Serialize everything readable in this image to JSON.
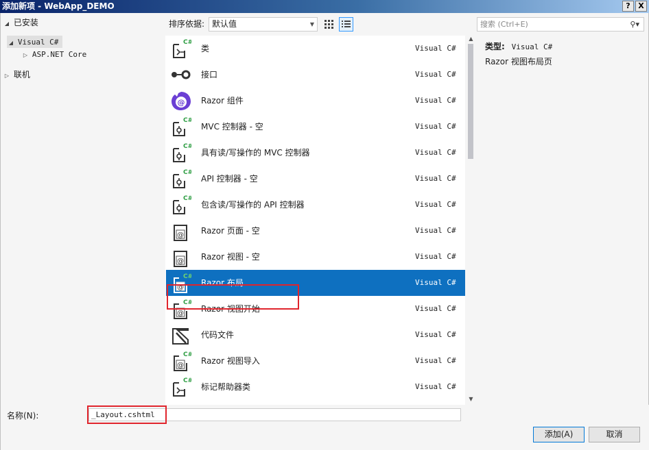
{
  "window": {
    "title": "添加新项 - WebApp_DEMO",
    "help_label": "?",
    "close_label": "X"
  },
  "tree": {
    "installed": "已安装",
    "visual_csharp": "Visual C#",
    "aspnet_core": "ASP.NET Core",
    "online": "联机"
  },
  "toolbar": {
    "sort_label": "排序依据:",
    "sort_value": "默认值"
  },
  "templates": [
    {
      "name": "类",
      "lang": "Visual C#",
      "icon": "class-cs-icon"
    },
    {
      "name": "接口",
      "lang": "Visual C#",
      "icon": "interface-icon"
    },
    {
      "name": "Razor 组件",
      "lang": "Visual C#",
      "icon": "razor-component-icon"
    },
    {
      "name": "MVC 控制器 - 空",
      "lang": "Visual C#",
      "icon": "controller-cs-icon"
    },
    {
      "name": "具有读/写操作的 MVC 控制器",
      "lang": "Visual C#",
      "icon": "controller-cs-icon"
    },
    {
      "name": "API 控制器 - 空",
      "lang": "Visual C#",
      "icon": "controller-cs-icon"
    },
    {
      "name": "包含读/写操作的 API 控制器",
      "lang": "Visual C#",
      "icon": "controller-cs-icon"
    },
    {
      "name": "Razor 页面 - 空",
      "lang": "Visual C#",
      "icon": "razor-page-icon"
    },
    {
      "name": "Razor 视图 - 空",
      "lang": "Visual C#",
      "icon": "razor-page-icon"
    },
    {
      "name": "Razor 布局",
      "lang": "Visual C#",
      "icon": "razor-layout-cs-icon"
    },
    {
      "name": "Razor 视图开始",
      "lang": "Visual C#",
      "icon": "razor-page-cs-icon"
    },
    {
      "name": "代码文件",
      "lang": "Visual C#",
      "icon": "code-file-icon"
    },
    {
      "name": "Razor 视图导入",
      "lang": "Visual C#",
      "icon": "razor-page-cs-icon"
    },
    {
      "name": "标记帮助器类",
      "lang": "Visual C#",
      "icon": "class-cs-icon"
    }
  ],
  "selected_index": 9,
  "search": {
    "placeholder": "搜索 (Ctrl+E)"
  },
  "details": {
    "type_label": "类型:",
    "type_value": "Visual C#",
    "description": "Razor 视图布局页"
  },
  "name_field": {
    "label": "名称(N):",
    "value": "_Layout.cshtml"
  },
  "buttons": {
    "add": "添加(A)",
    "cancel": "取消"
  },
  "colors": {
    "selection": "#0e70c0",
    "highlight_box": "#e0242c",
    "cs_badge": "#2f9e44",
    "razor_purple": "#6b3fd4"
  }
}
